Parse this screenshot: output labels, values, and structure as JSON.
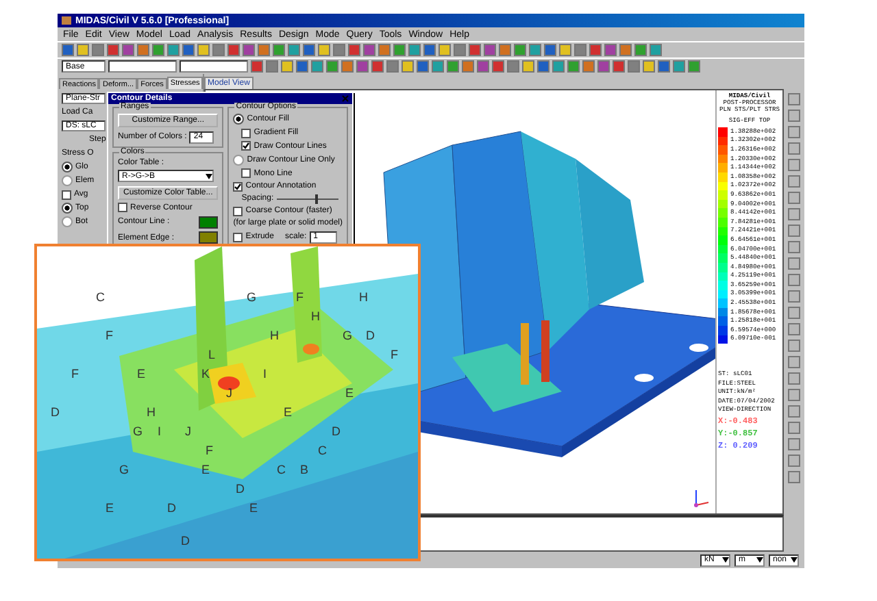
{
  "window": {
    "title": "MIDAS/Civil V 5.6.0 [Professional]"
  },
  "menu": [
    "File",
    "Edit",
    "View",
    "Model",
    "Load",
    "Analysis",
    "Results",
    "Design",
    "Mode",
    "Query",
    "Tools",
    "Window",
    "Help"
  ],
  "toolbar": {
    "base_combo": "Base"
  },
  "result_tabs": [
    {
      "label": "Reactions",
      "selected": false
    },
    {
      "label": "Deform...",
      "selected": false
    },
    {
      "label": "Forces",
      "selected": false
    },
    {
      "label": "Stresses",
      "selected": true
    }
  ],
  "view_tabs": [
    {
      "label": "Model View",
      "selected": true
    }
  ],
  "left_panel": [
    {
      "kind": "field",
      "text": "Plane-Str"
    },
    {
      "kind": "group",
      "text": "Load Ca"
    },
    {
      "kind": "combo",
      "text": "DS: sLC"
    },
    {
      "kind": "button",
      "text": "Step"
    },
    {
      "kind": "group",
      "text": "Stress O"
    },
    {
      "kind": "radio",
      "text": "Glo",
      "selected": true
    },
    {
      "kind": "radio",
      "text": "Elem",
      "selected": false
    },
    {
      "kind": "check",
      "text": "Avg",
      "checked": false
    },
    {
      "kind": "radio",
      "text": "Top",
      "selected": true
    },
    {
      "kind": "radio",
      "text": "Bot",
      "selected": false
    }
  ],
  "dialog": {
    "title": "Contour Details",
    "ranges": {
      "label": "Ranges",
      "button": "Customize Range...",
      "count_label": "Number of Colors :",
      "count": "24"
    },
    "colors": {
      "label": "Colors",
      "table_label": "Color Table :",
      "table": "R->G->B",
      "button": "Customize Color Table...",
      "reverse": {
        "label": "Reverse Contour",
        "checked": false
      },
      "swatches": [
        {
          "label": "Contour Line :",
          "color": "#008000"
        },
        {
          "label": "Element Edge :",
          "color": "#808000"
        }
      ]
    },
    "options": {
      "label": "Contour Options",
      "fill": {
        "label": "Contour Fill",
        "selected": true
      },
      "gradient": {
        "label": "Gradient Fill",
        "checked": false
      },
      "draw_lines": {
        "label": "Draw Contour Lines",
        "checked": true
      },
      "line_only": {
        "label": "Draw Contour Line Only",
        "selected": false
      },
      "mono": {
        "label": "Mono Line",
        "checked": false
      },
      "annotation": {
        "label": "Contour Annotation",
        "checked": true
      },
      "spacing": {
        "label": "Spacing:",
        "level": 0.62
      },
      "coarse": {
        "label": "Coarse Contour (faster)",
        "checked": false
      },
      "note": "(for large plate or solid model)",
      "extrude": {
        "label": "Extrude",
        "checked": false
      },
      "scale_label": "scale:",
      "scale": "1"
    }
  },
  "legend": {
    "header": [
      "MIDAS/Civil",
      "POST-PROCESSOR",
      "PLN STS/PLT STRS"
    ],
    "title": "SIG-EFF TOP",
    "values": [
      "1.38288e+002",
      "1.32302e+002",
      "1.26316e+002",
      "1.20330e+002",
      "1.14344e+002",
      "1.08358e+002",
      "1.02372e+002",
      "9.63862e+001",
      "9.04002e+001",
      "8.44142e+001",
      "7.84281e+001",
      "7.24421e+001",
      "6.64561e+001",
      "6.04700e+001",
      "5.44840e+001",
      "4.84980e+001",
      "4.25119e+001",
      "3.65259e+001",
      "3.05399e+001",
      "2.45538e+001",
      "1.85678e+001",
      "1.25818e+001",
      "6.59574e+000",
      "6.09710e-001"
    ],
    "footer": [
      "ST: sLC01",
      "FILE:STEEL",
      "UNIT:kN/m²",
      "DATE:07/04/2002",
      "VIEW-DIRECTION"
    ],
    "directions": [
      {
        "text": "X:-0.483",
        "color": "#ff6060"
      },
      {
        "text": "Y:-0.857",
        "color": "#40c040"
      },
      {
        "text": "Z: 0.209",
        "color": "#6060ff"
      }
    ]
  },
  "status_bar": {
    "units": [
      "kN",
      "m",
      "non"
    ]
  },
  "inset_labels": [
    "C",
    "G",
    "F",
    "H",
    "H",
    "F",
    "H",
    "G",
    "D",
    "L",
    "F",
    "F",
    "E",
    "K",
    "I",
    "J",
    "E",
    "D",
    "H",
    "E",
    "G",
    "I",
    "J",
    "D",
    "F",
    "C",
    "G",
    "E",
    "C",
    "B",
    "D",
    "E",
    "D",
    "E",
    "D"
  ]
}
